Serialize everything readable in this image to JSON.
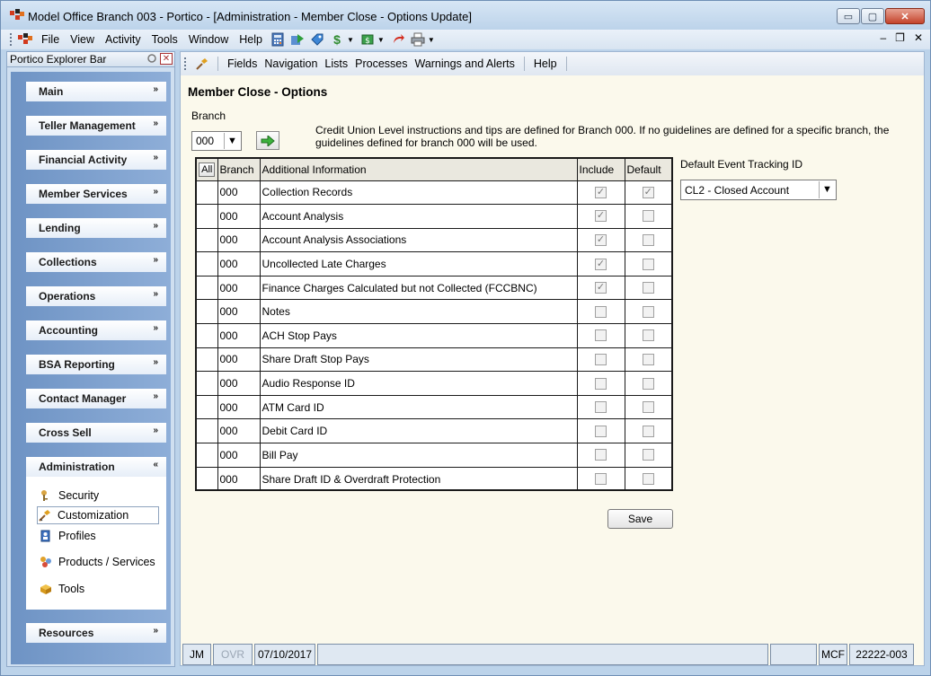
{
  "window": {
    "title": "Model Office Branch 003 - Portico - [Administration - Member Close - Options Update]",
    "controls": {
      "minimize": "▭",
      "maximize": "▢",
      "close": "✕"
    }
  },
  "menubar": {
    "items": [
      "File",
      "View",
      "Activity",
      "Tools",
      "Window",
      "Help"
    ],
    "mdi_controls": {
      "minimize": "–",
      "restore": "❐",
      "close": "✕"
    }
  },
  "explorer": {
    "title": "Portico Explorer Bar",
    "groups": [
      {
        "label": "Main",
        "chevron": "»"
      },
      {
        "label": "Teller Management",
        "chevron": "»"
      },
      {
        "label": "Financial Activity",
        "chevron": "»"
      },
      {
        "label": "Member Services",
        "chevron": "»"
      },
      {
        "label": "Lending",
        "chevron": "»"
      },
      {
        "label": "Collections",
        "chevron": "»"
      },
      {
        "label": "Operations",
        "chevron": "»"
      },
      {
        "label": "Accounting",
        "chevron": "»"
      },
      {
        "label": "BSA Reporting",
        "chevron": "»"
      },
      {
        "label": "Contact Manager",
        "chevron": "»"
      },
      {
        "label": "Cross Sell",
        "chevron": "»"
      },
      {
        "label": "Administration",
        "chevron": "«"
      },
      {
        "label": "Resources",
        "chevron": "»"
      }
    ],
    "admin_links": [
      {
        "label": "Security",
        "icon": "security-icon"
      },
      {
        "label": "Customization",
        "icon": "customization-icon",
        "selected": true
      },
      {
        "label": "Profiles",
        "icon": "profiles-icon"
      },
      {
        "label": "Products / Services",
        "icon": "products-icon"
      },
      {
        "label": "Tools",
        "icon": "tools-icon"
      }
    ]
  },
  "subbar": {
    "items": [
      "Fields",
      "Navigation",
      "Lists",
      "Processes",
      "Warnings and Alerts",
      "Help"
    ]
  },
  "main": {
    "title": "Member Close - Options",
    "branch_label": "Branch",
    "branch_value": "000",
    "info_text": "Credit Union Level instructions and tips are defined for Branch 000. If no guidelines are defined for a specific branch, the guidelines defined for branch 000 will be used.",
    "grid": {
      "all_label": "All",
      "headers": {
        "branch": "Branch",
        "info": "Additional Information",
        "include": "Include",
        "default": "Default"
      },
      "rows": [
        {
          "branch": "000",
          "info": "Collection Records",
          "include": true,
          "default": true
        },
        {
          "branch": "000",
          "info": "Account Analysis",
          "include": true,
          "default": false
        },
        {
          "branch": "000",
          "info": "Account Analysis Associations",
          "include": true,
          "default": false
        },
        {
          "branch": "000",
          "info": "Uncollected Late Charges",
          "include": true,
          "default": false
        },
        {
          "branch": "000",
          "info": "Finance Charges Calculated but not Collected (FCCBNC)",
          "include": true,
          "default": false
        },
        {
          "branch": "000",
          "info": "Notes",
          "include": false,
          "default": false
        },
        {
          "branch": "000",
          "info": "ACH Stop Pays",
          "include": false,
          "default": false
        },
        {
          "branch": "000",
          "info": "Share Draft Stop Pays",
          "include": false,
          "default": false
        },
        {
          "branch": "000",
          "info": "Audio Response ID",
          "include": false,
          "default": false
        },
        {
          "branch": "000",
          "info": "ATM Card ID",
          "include": false,
          "default": false
        },
        {
          "branch": "000",
          "info": "Debit Card ID",
          "include": false,
          "default": false
        },
        {
          "branch": "000",
          "info": "Bill Pay",
          "include": false,
          "default": false
        },
        {
          "branch": "000",
          "info": "Share Draft ID & Overdraft Protection",
          "include": false,
          "default": false
        }
      ]
    },
    "tracking_label": "Default Event Tracking ID",
    "tracking_value": "CL2 - Closed Account",
    "save_label": "Save"
  },
  "statusbar": {
    "user": "JM",
    "ovr": "OVR",
    "date": "07/10/2017",
    "blank1": "",
    "blank2": "",
    "mcf": "MCF",
    "code": "22222-003"
  },
  "colors": {
    "accent": "#3a6ea5",
    "background": "#fbf9ec"
  }
}
